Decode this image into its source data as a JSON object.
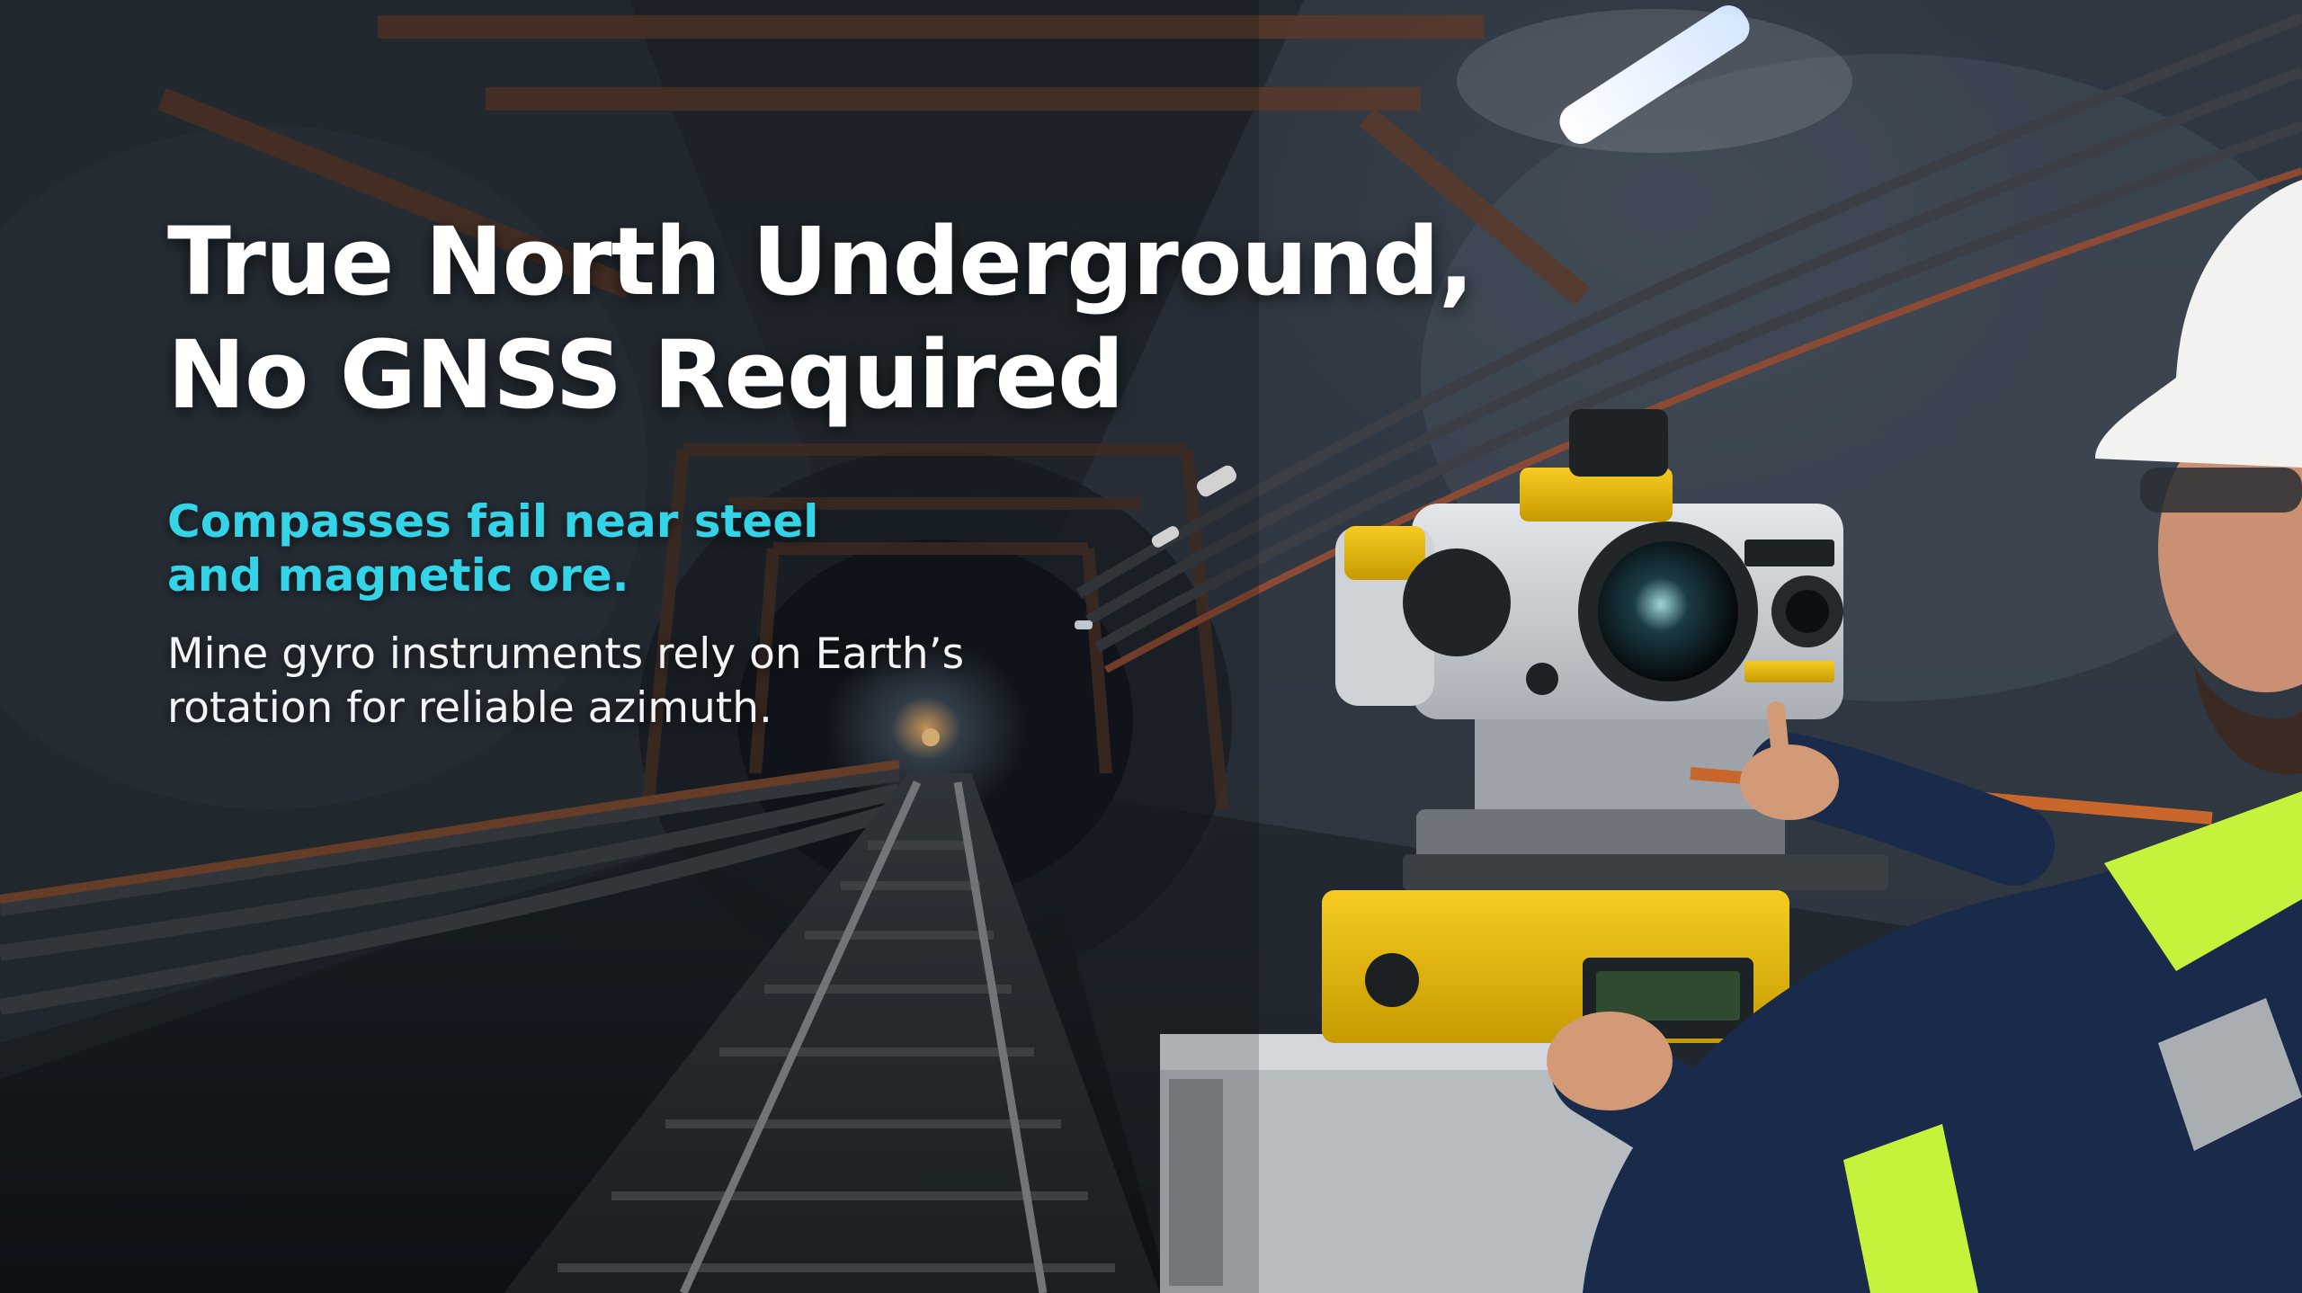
{
  "poster": {
    "headline_line1": "True North Underground,",
    "headline_line2": "No GNSS Required",
    "subhead_line1": "Compasses fail near steel",
    "subhead_line2": "and magnetic ore.",
    "body_line1": "Mine gyro instruments rely on Earth’s",
    "body_line2": "rotation for reliable azimuth."
  },
  "colors": {
    "headline": "#ffffff",
    "subhead": "#34d4e8",
    "body": "#f2f4f6",
    "instrument_accent": "#f2c200"
  }
}
